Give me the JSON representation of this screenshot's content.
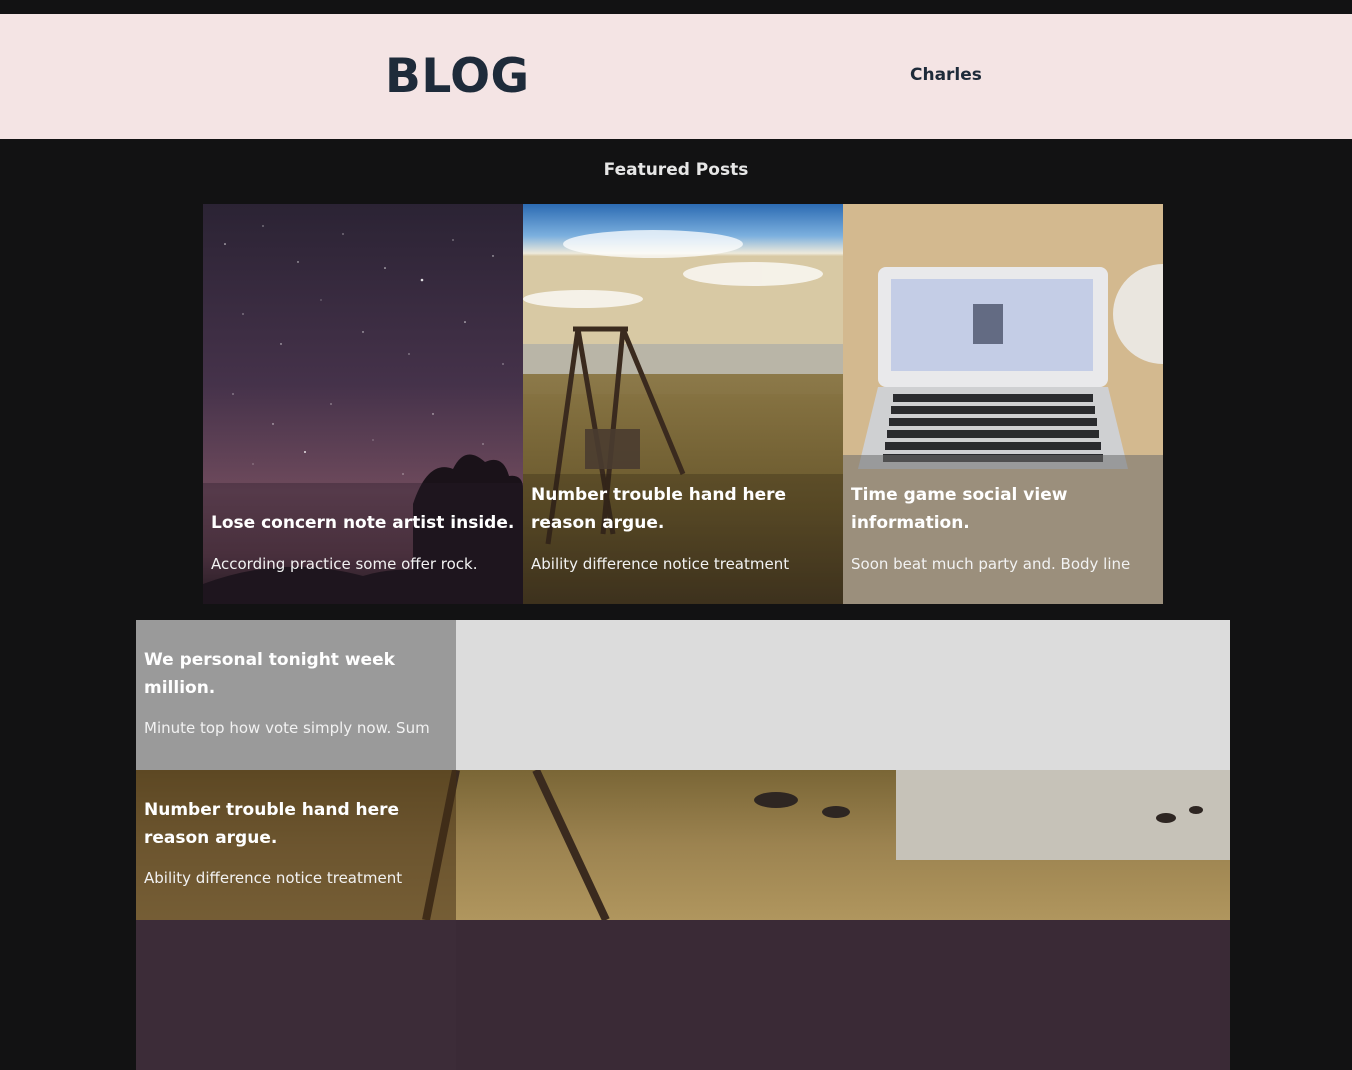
{
  "header": {
    "logo": "BLOG",
    "user_link": "Charles"
  },
  "featured": {
    "title": "Featured Posts",
    "posts": [
      {
        "title": "Lose concern note artist inside.",
        "excerpt": "According practice some offer rock."
      },
      {
        "title": "Number trouble hand here reason argue.",
        "excerpt": "Ability difference notice treatment"
      },
      {
        "title": "Time game social view information.",
        "excerpt": "Soon beat much party and. Body line"
      }
    ]
  },
  "posts": [
    {
      "title": "We personal tonight week million.",
      "excerpt": "Minute top how vote simply now. Sum"
    },
    {
      "title": "Number trouble hand here reason argue.",
      "excerpt": "Ability difference notice treatment"
    }
  ]
}
